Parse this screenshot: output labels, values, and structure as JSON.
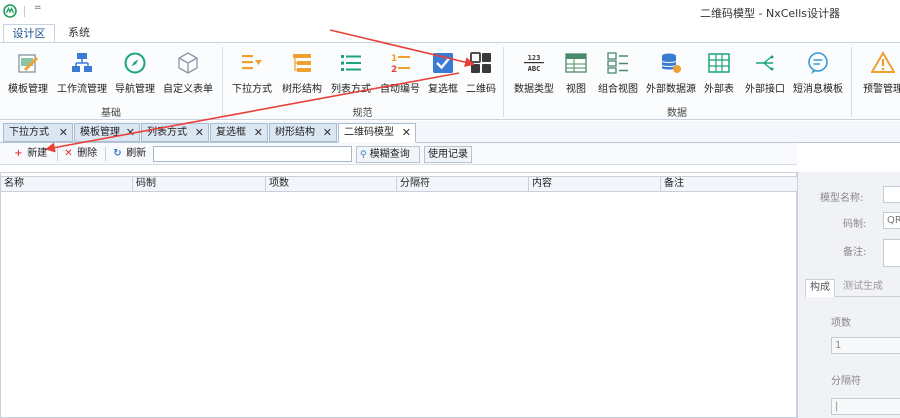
{
  "window": {
    "title": "二维码模型 - NxCells设计器",
    "qa_menu": "="
  },
  "ribbon_tabs": [
    "设计区",
    "系统"
  ],
  "ribbon": {
    "groups": {
      "basic": "基础",
      "standard": "规范",
      "data": "数据"
    },
    "buttons": {
      "template_mgmt": "模板管理",
      "workflow_mgmt": "工作流管理",
      "nav_mgmt": "导航管理",
      "custom_form": "自定义表单",
      "dropdown_mode": "下拉方式",
      "tree_struct": "树形结构",
      "list_mode": "列表方式",
      "auto_number": "自动编号",
      "checkbox": "复选框",
      "qrcode": "二维码",
      "data_type": "数据类型",
      "view": "视图",
      "combined_view": "组合视图",
      "external_ds": "外部数据源",
      "external_table": "外部表",
      "external_api": "外部接口",
      "sms_template": "短消息模板",
      "alert_mgmt": "预警管理"
    },
    "data_type_icon_text": {
      "top": "123",
      "bottom": "ABC"
    }
  },
  "doc_tabs": [
    {
      "label": "下拉方式",
      "close": "✕"
    },
    {
      "label": "模板管理",
      "close": "✕"
    },
    {
      "label": "列表方式",
      "close": "✕"
    },
    {
      "label": "复选框",
      "close": "✕"
    },
    {
      "label": "树形结构",
      "close": "✕"
    },
    {
      "label": "二维码模型",
      "close": "✕"
    }
  ],
  "toolbar": {
    "new_label": "新建",
    "delete_label": "删除",
    "refresh_label": "刷新",
    "search_value": "",
    "fuzzy_query_label": "模糊查询",
    "history_label": "使用记录"
  },
  "table": {
    "columns": [
      "名称",
      "码制",
      "项数",
      "分隔符",
      "内容",
      "备注"
    ],
    "rows": []
  },
  "panel": {
    "model_name_label": "模型名称:",
    "code_system_label": "码制:",
    "code_system_value": "QR",
    "remark_label": "备注:",
    "tabs": [
      "构成",
      "测试生成"
    ],
    "item_count_label": "项数",
    "item_count_value": "1",
    "separator_label": "分隔符",
    "separator_value": "|"
  },
  "colors": {
    "accent": "#1a4f8c",
    "annotation_arrow": "#e8413a",
    "qrcode_icon": "#3a3a3a"
  }
}
